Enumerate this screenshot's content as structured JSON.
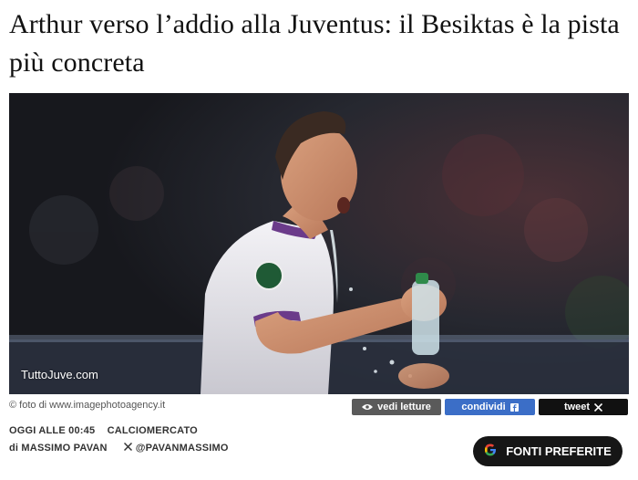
{
  "article": {
    "title": "Arthur verso l’addio alla Juventus: il Besiktas è la pista più concreta",
    "image_watermark": "TuttoJuve.com",
    "photo_credit": "© foto di www.imagephotoagency.it"
  },
  "actions": {
    "views_label": "vedi letture",
    "share_label": "condividi",
    "tweet_label": "tweet"
  },
  "meta": {
    "date": "OGGI ALLE 00:45",
    "category": "CALCIOMERCATO",
    "author": "di MASSIMO PAVAN",
    "x_handle": "@PAVANMASSIMO"
  },
  "fonti_button": {
    "label": "FONTI PREFERITE"
  },
  "colors": {
    "views_button": "#5a5a5a",
    "share_button": "#3b6ec7",
    "tweet_button": "#111111",
    "fonti_button": "#161616"
  },
  "icons": {
    "views": "eye-icon",
    "share": "facebook-icon",
    "tweet": "x-icon",
    "author_x": "x-icon",
    "fonti": "google-icon"
  }
}
